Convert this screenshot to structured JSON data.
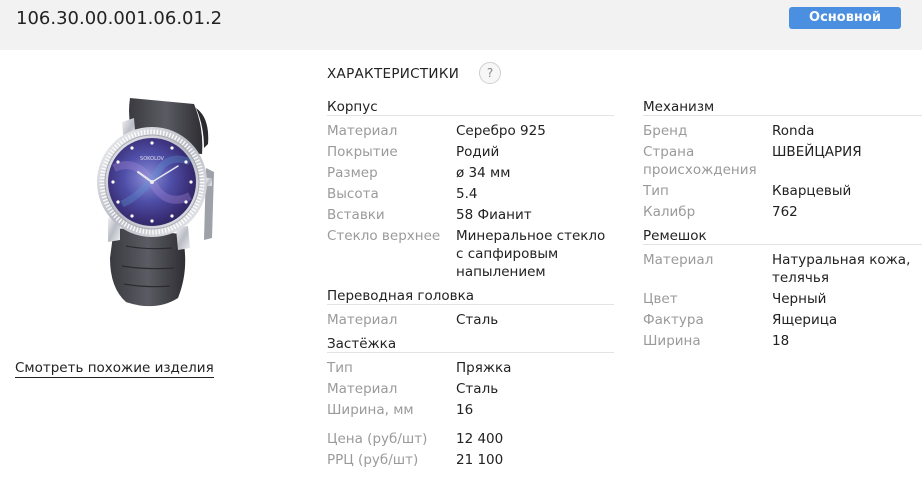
{
  "header": {
    "article": "106.30.00.001.06.01.2",
    "badge_label": "Основной"
  },
  "product": {
    "similar_link": "Смотреть похожие изделия",
    "dial_brand": "SOKOLOV"
  },
  "specs": {
    "title": "ХАРАКТЕРИСТИКИ",
    "help_glyph": "?",
    "groups": {
      "case": {
        "title": "Корпус",
        "rows": [
          {
            "label": "Материал",
            "value": "Серебро 925"
          },
          {
            "label": "Покрытие",
            "value": "Родий"
          },
          {
            "label": "Размер",
            "value": "ø 34 мм"
          },
          {
            "label": "Высота",
            "value": "5.4"
          },
          {
            "label": "Вставки",
            "value": "58 Фианит"
          },
          {
            "label": "Стекло верхнее",
            "value_lines": [
              "Минеральное стекло",
              "с сапфировым",
              "напылением"
            ]
          }
        ]
      },
      "crown": {
        "title": "Переводная головка",
        "rows": [
          {
            "label": "Материал",
            "value": "Сталь"
          }
        ]
      },
      "clasp": {
        "title": "Застёжка",
        "rows": [
          {
            "label": "Тип",
            "value": "Пряжка"
          },
          {
            "label": "Материал",
            "value": "Сталь"
          },
          {
            "label": "Ширина, мм",
            "value": "16"
          }
        ]
      },
      "prices": {
        "rows": [
          {
            "label": "Цена (руб/шт)",
            "value": "12 400"
          },
          {
            "label": "РРЦ (руб/шт)",
            "value": "21 100"
          }
        ]
      },
      "movement": {
        "title": "Механизм",
        "rows": [
          {
            "label": "Бренд",
            "value": "Ronda"
          },
          {
            "label_lines": [
              "Страна",
              "происхождения"
            ],
            "value": "ШВЕЙЦАРИЯ"
          },
          {
            "label": "Тип",
            "value": "Кварцевый"
          },
          {
            "label": "Калибр",
            "value": "762"
          }
        ]
      },
      "strap": {
        "title": "Ремешок",
        "rows": [
          {
            "label": "Материал",
            "value_lines": [
              "Натуральная кожа,",
              "телячья"
            ]
          },
          {
            "label": "Цвет",
            "value": "Черный"
          },
          {
            "label": "Фактура",
            "value": "Ящерица"
          },
          {
            "label": "Ширина",
            "value": "18"
          }
        ]
      }
    }
  },
  "colors": {
    "accent": "#4a8fe0",
    "header_bg": "#f2f2f2",
    "label": "#9a9a9a",
    "text": "#222222"
  },
  "icons": {
    "help": "question-circle-icon"
  }
}
